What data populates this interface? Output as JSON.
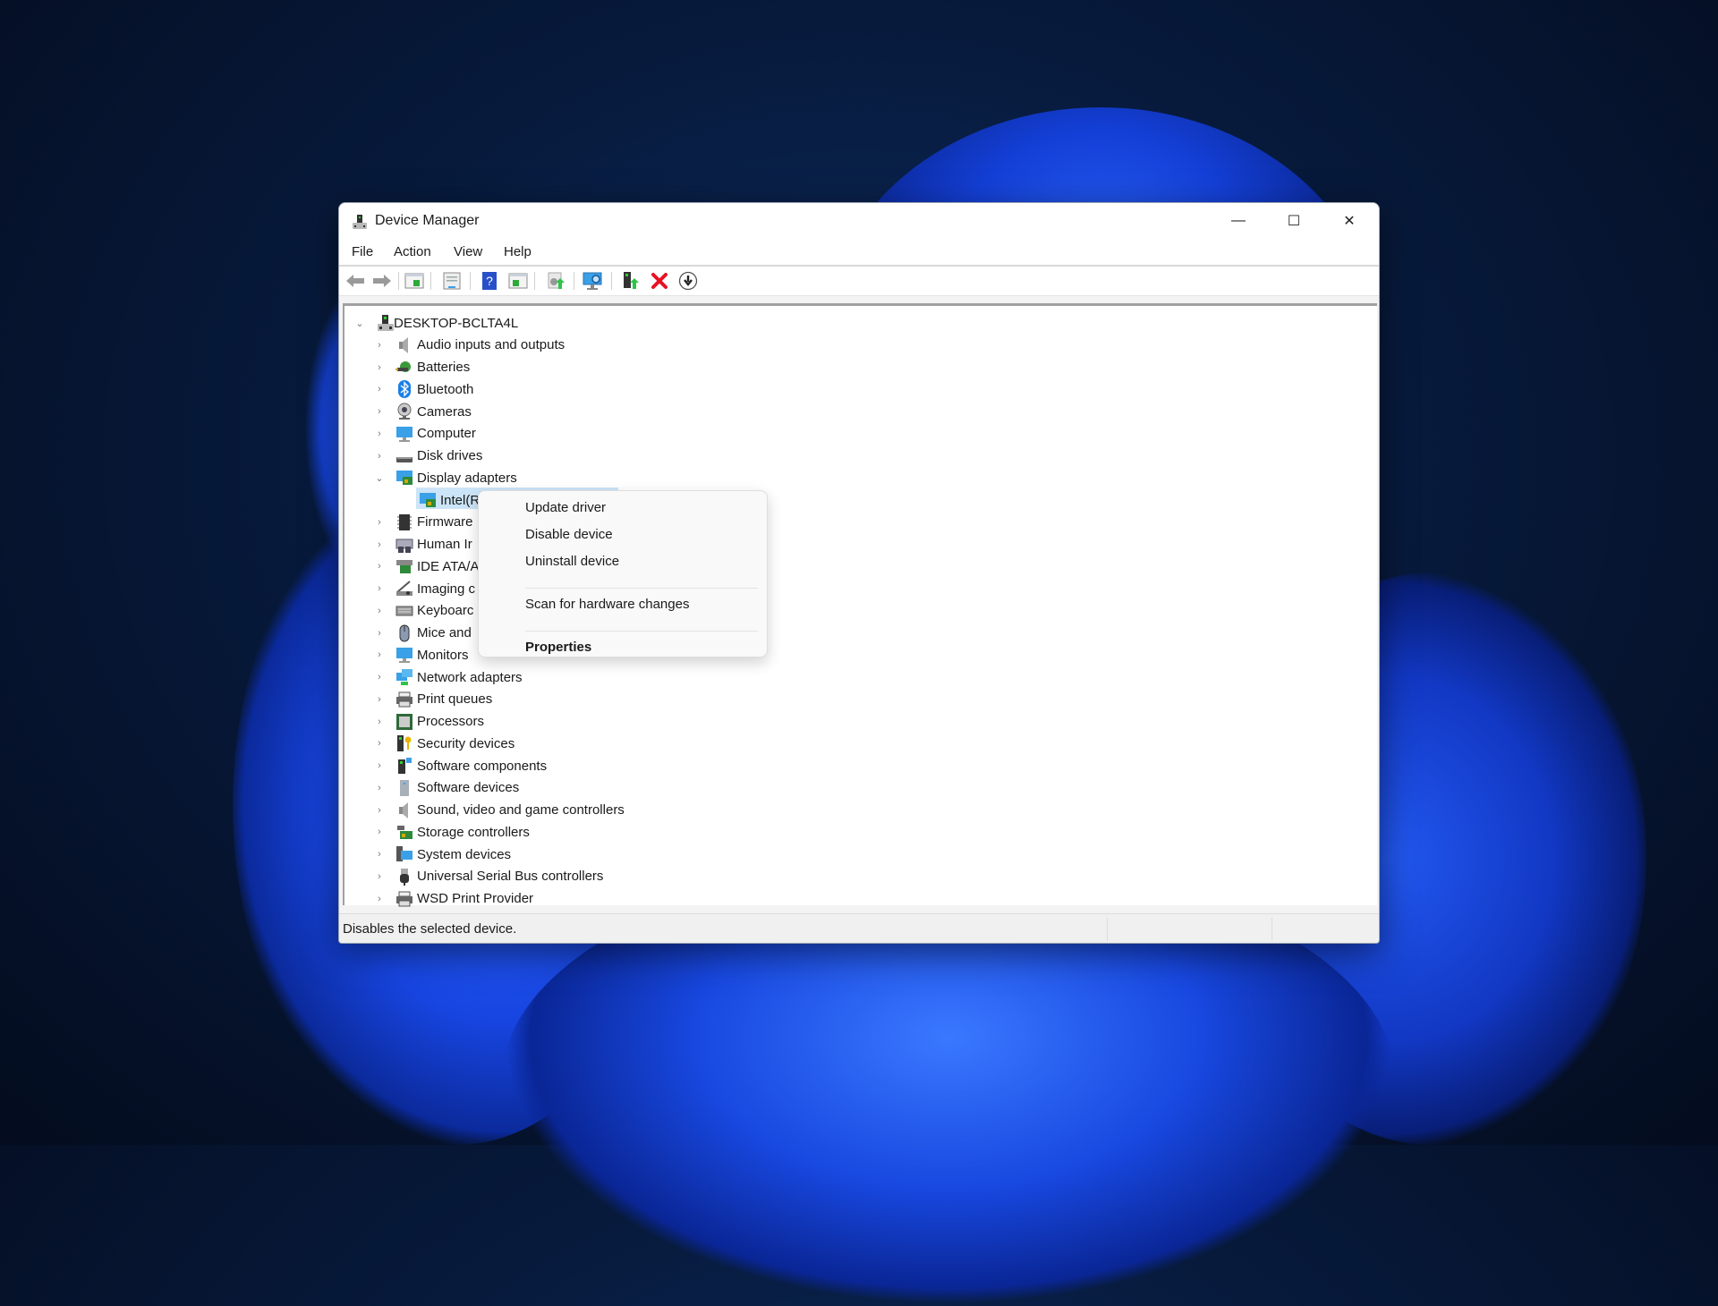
{
  "window": {
    "title": "Device Manager",
    "controls": {
      "minimize": "—",
      "maximize": "☐",
      "close": "✕"
    }
  },
  "menubar": [
    "File",
    "Action",
    "View",
    "Help"
  ],
  "toolbar": [
    {
      "name": "back-icon"
    },
    {
      "name": "forward-icon"
    },
    {
      "name": "show-hide-console-tree-icon"
    },
    {
      "name": "properties-icon"
    },
    {
      "name": "help-icon"
    },
    {
      "name": "show-action-pane-icon"
    },
    {
      "name": "update-driver-icon"
    },
    {
      "name": "scan-hardware-icon"
    },
    {
      "name": "enable-device-icon"
    },
    {
      "name": "uninstall-device-icon"
    },
    {
      "name": "disable-device-icon"
    }
  ],
  "tree": {
    "root": {
      "label": "DESKTOP-BCLTA4L",
      "expanded": true
    },
    "categories": [
      {
        "label": "Audio inputs and outputs",
        "icon": "speaker"
      },
      {
        "label": "Batteries",
        "icon": "battery"
      },
      {
        "label": "Bluetooth",
        "icon": "bluetooth"
      },
      {
        "label": "Cameras",
        "icon": "camera"
      },
      {
        "label": "Computer",
        "icon": "monitor"
      },
      {
        "label": "Disk drives",
        "icon": "disk"
      },
      {
        "label": "Display adapters",
        "icon": "display-adapter",
        "expanded": true,
        "children": [
          {
            "label": "Intel(R",
            "selected": true
          }
        ]
      },
      {
        "label": "Firmware",
        "icon": "chip"
      },
      {
        "label": "Human Ir",
        "icon": "hid"
      },
      {
        "label": "IDE ATA/A",
        "icon": "ide"
      },
      {
        "label": "Imaging c",
        "icon": "scanner"
      },
      {
        "label": "Keyboarc",
        "icon": "keyboard"
      },
      {
        "label": "Mice and",
        "icon": "mouse"
      },
      {
        "label": "Monitors",
        "icon": "monitor"
      },
      {
        "label": "Network adapters",
        "icon": "network"
      },
      {
        "label": "Print queues",
        "icon": "printer"
      },
      {
        "label": "Processors",
        "icon": "cpu"
      },
      {
        "label": "Security devices",
        "icon": "security"
      },
      {
        "label": "Software components",
        "icon": "sw-component"
      },
      {
        "label": "Software devices",
        "icon": "sw-device"
      },
      {
        "label": "Sound, video and game controllers",
        "icon": "speaker"
      },
      {
        "label": "Storage controllers",
        "icon": "storage"
      },
      {
        "label": "System devices",
        "icon": "system"
      },
      {
        "label": "Universal Serial Bus controllers",
        "icon": "usb"
      },
      {
        "label": "WSD Print Provider",
        "icon": "printer"
      }
    ]
  },
  "context_menu": {
    "items": [
      {
        "label": "Update driver",
        "bold": false
      },
      {
        "label": "Disable device",
        "bold": false
      },
      {
        "label": "Uninstall device",
        "bold": false
      },
      {
        "separator": true
      },
      {
        "label": "Scan for hardware changes",
        "bold": false
      },
      {
        "separator": true
      },
      {
        "label": "Properties",
        "bold": true
      }
    ]
  },
  "statusbar": {
    "text": "Disables the selected device."
  },
  "colors": {
    "selection": "#cce4f7",
    "accent": "#0067c0",
    "delete_red": "#e81123"
  }
}
